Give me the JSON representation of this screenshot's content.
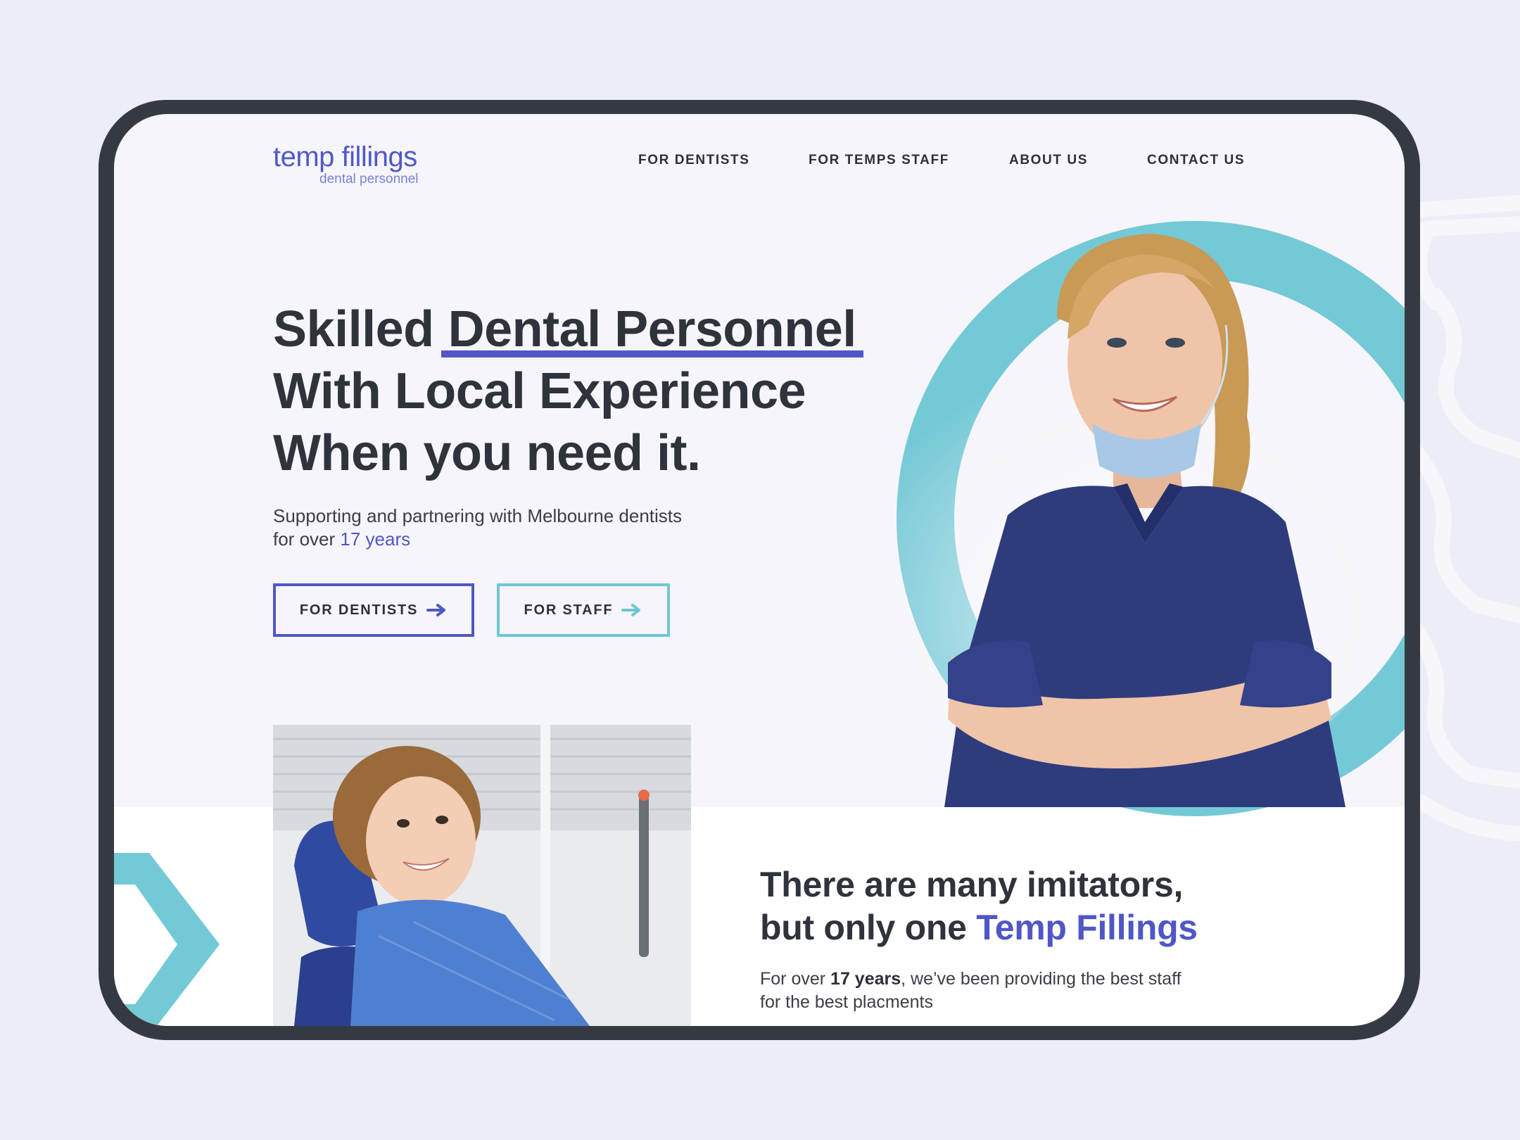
{
  "brand": {
    "name": "temp fillings",
    "tagline": "dental personnel",
    "accent_color": "#4f57c6",
    "teal_color": "#6dc7d3",
    "text_color": "#2f333b"
  },
  "nav": {
    "items": [
      {
        "label": "FOR DENTISTS"
      },
      {
        "label": "FOR TEMPS STAFF"
      },
      {
        "label": "ABOUT US"
      },
      {
        "label": "CONTACT US"
      }
    ]
  },
  "hero": {
    "title_word1": "Skilled",
    "title_highlight": "Dental Personnel",
    "title_line2": "With Local Experience",
    "title_line3": "When you need it.",
    "subtitle_line1": "Supporting and partnering with Melbourne dentists",
    "subtitle_prefix": "for over",
    "subtitle_accent": "17 years",
    "buttons": {
      "dentists_label": "FOR DENTISTS",
      "staff_label": "FOR STAFF",
      "arrow_icon": "arrow-right-icon"
    }
  },
  "section": {
    "title_line1": "There are many imitators,",
    "title_line2_prefix": "but only one",
    "title_line2_accent": "Temp Fillings",
    "text_prefix": "For over",
    "text_bold": "17 years",
    "text_rest": ", we’ve been providing the best staff",
    "text_line2": "for the best placments"
  }
}
